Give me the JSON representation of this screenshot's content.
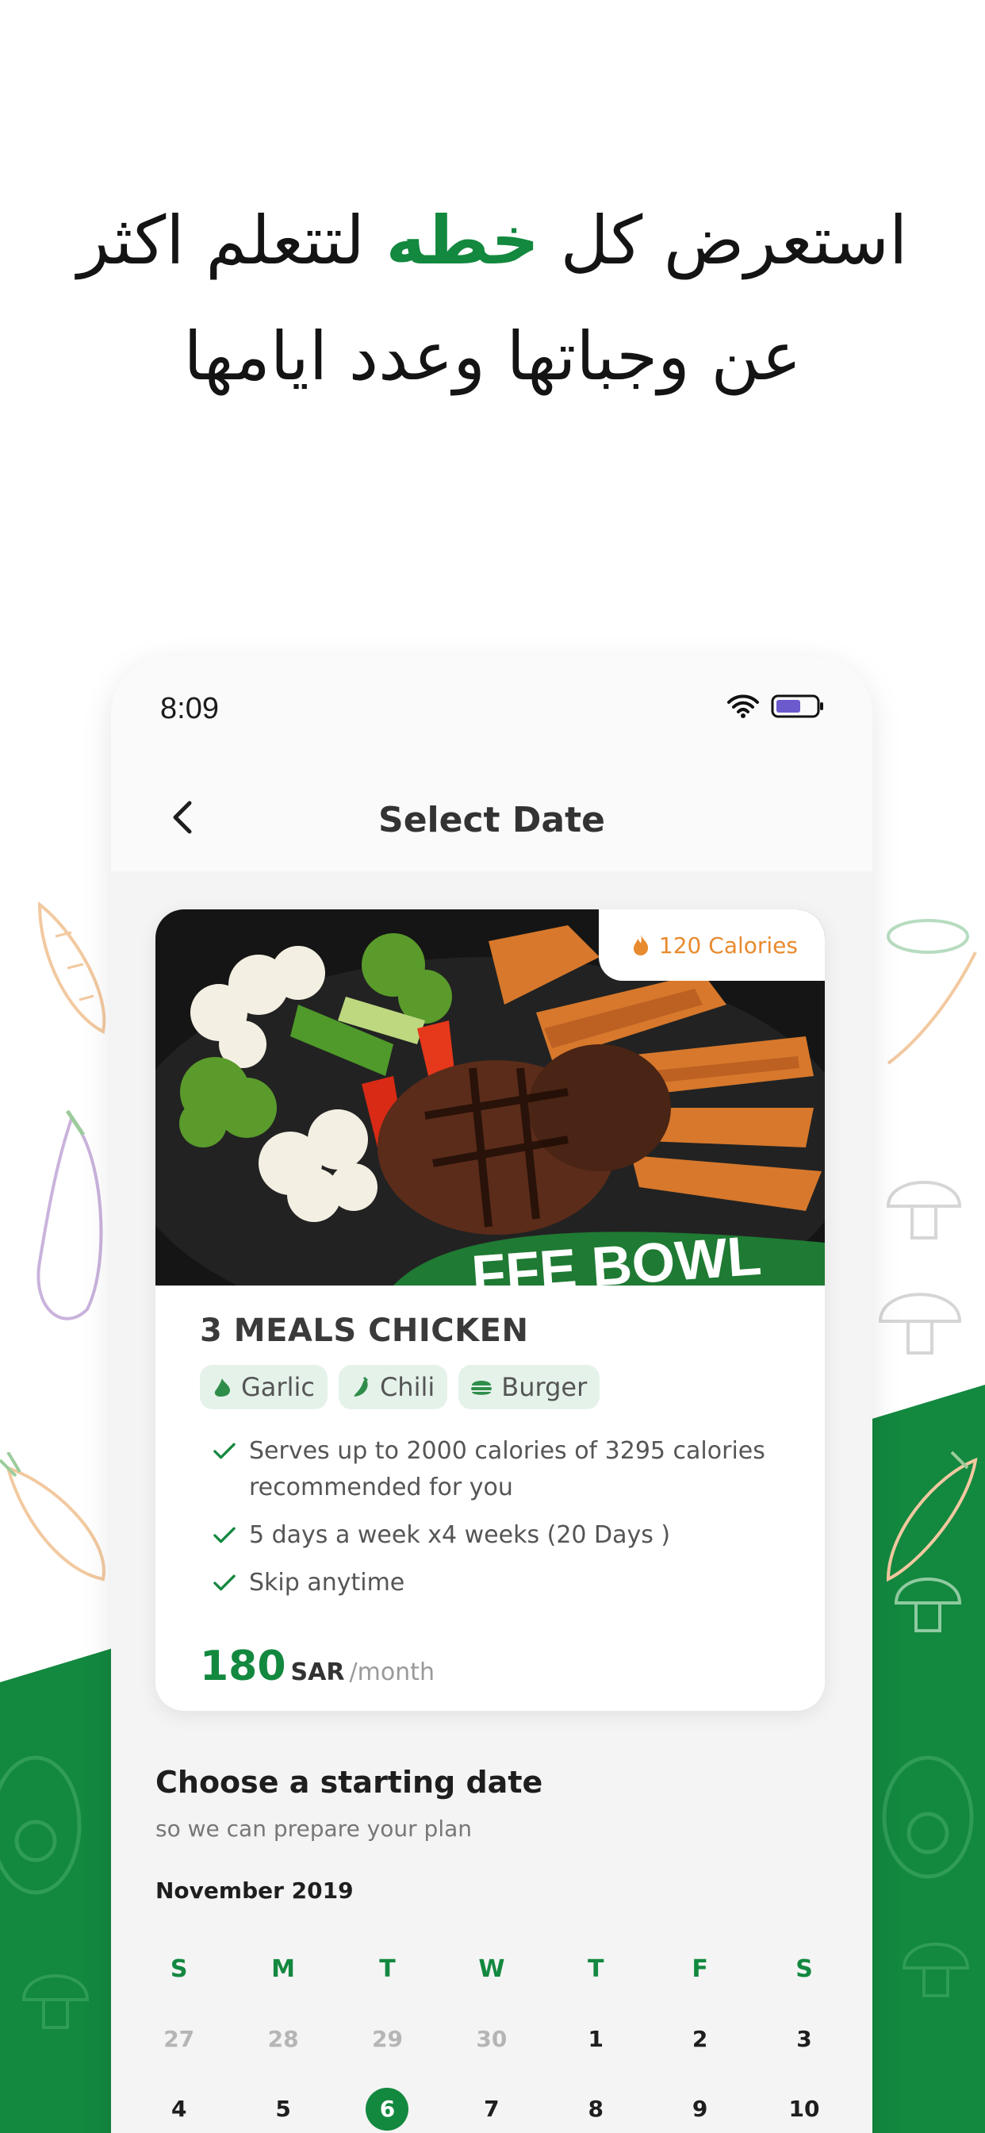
{
  "promo": {
    "headline_before": "استعرض كل ",
    "headline_highlight": "خطه",
    "headline_after": " لتتعلم اكثر عن وجباتها وعدد ايامها"
  },
  "status_bar": {
    "time": "8:09"
  },
  "nav": {
    "title": "Select Date"
  },
  "meal_card": {
    "calories_badge": "120 Calories",
    "title": "3 MEALS CHICKEN",
    "tags": [
      "Garlic",
      "Chili",
      "Burger"
    ],
    "features": [
      "Serves up to 2000 calories of 3295 calories recommended for you",
      "5 days a week x4 weeks (20 Days )",
      "Skip anytime"
    ],
    "image_text": "FFE BOWL",
    "price": {
      "value": "180",
      "currency": "SAR",
      "period": "/month"
    }
  },
  "start_date": {
    "title": "Choose a starting date",
    "subtitle": "so we can prepare your plan",
    "month": "November 2019",
    "weekdays": [
      "S",
      "M",
      "T",
      "W",
      "T",
      "F",
      "S"
    ],
    "rows": [
      [
        "27",
        "28",
        "29",
        "30",
        "1",
        "2",
        "3"
      ],
      [
        "4",
        "5",
        "6",
        "7",
        "8",
        "9",
        "10"
      ]
    ],
    "muted_days": [
      "27",
      "28",
      "29",
      "30"
    ],
    "selected_day": "6"
  },
  "colors": {
    "brand_green": "#13883f",
    "accent_orange": "#e88a2e"
  }
}
